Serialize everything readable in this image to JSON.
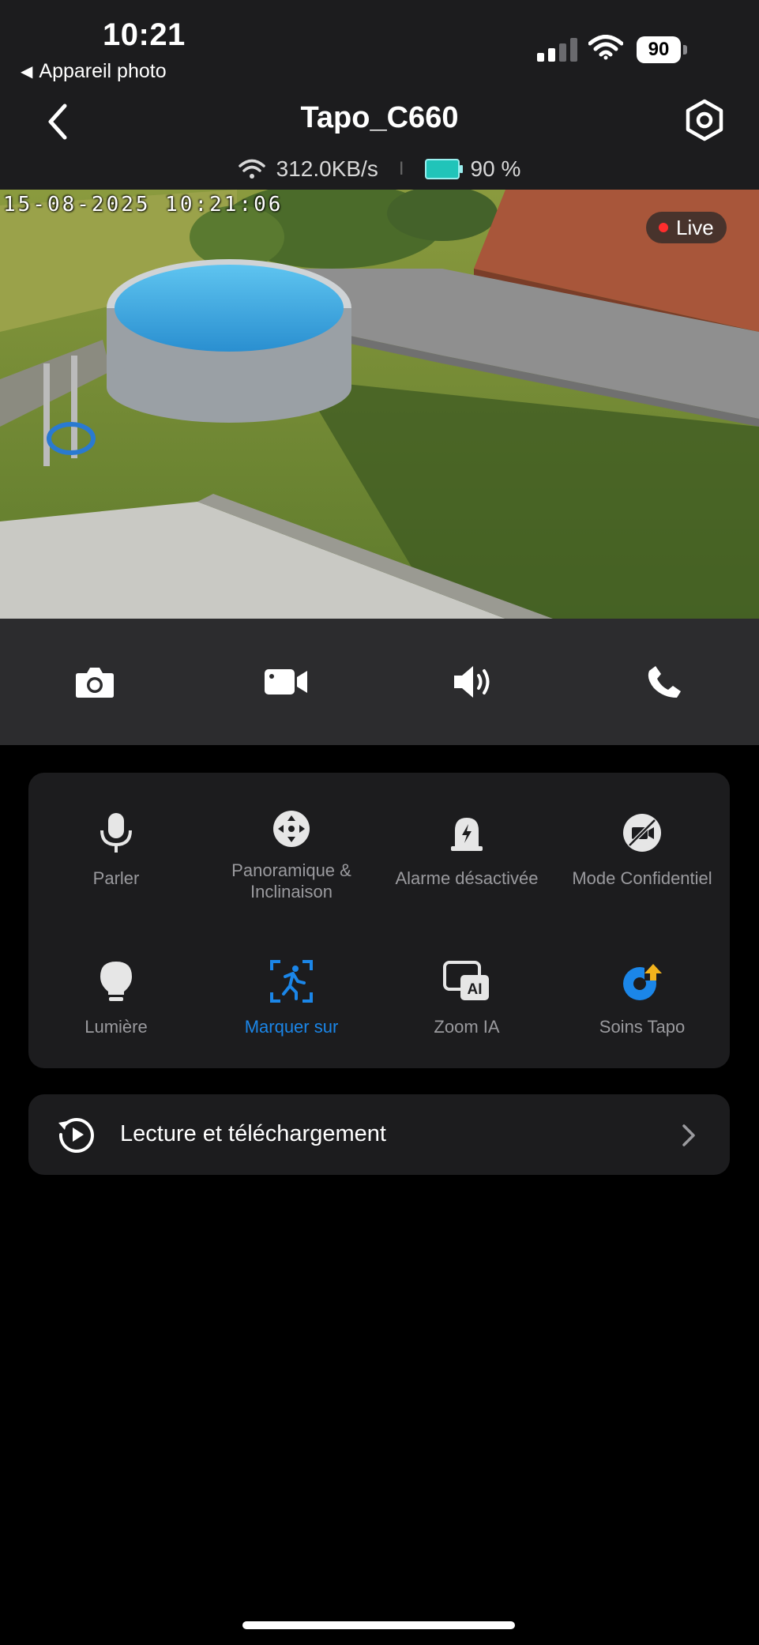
{
  "status_bar": {
    "time": "10:21",
    "back_app": "Appareil photo",
    "battery": "90"
  },
  "header": {
    "title": "Tapo_C660",
    "speed": "312.0KB/s",
    "separator": "I",
    "battery_pct": "90 %"
  },
  "camera": {
    "timestamp": "15-08-2025  10:21:06",
    "live_label": "Live"
  },
  "controls": [
    "camera-icon",
    "video-record-icon",
    "speaker-icon",
    "phone-icon"
  ],
  "features": {
    "items": [
      {
        "label": "Parler",
        "icon": "microphone-icon"
      },
      {
        "label": "Panoramique &\nInclinaison",
        "icon": "pan-tilt-icon"
      },
      {
        "label": "Alarme désactivée",
        "icon": "alarm-icon"
      },
      {
        "label": "Mode Confidentiel",
        "icon": "privacy-icon"
      },
      {
        "label": "Lumière",
        "icon": "light-bulb-icon"
      },
      {
        "label": "Marquer sur",
        "icon": "motion-tracking-icon",
        "active": true
      },
      {
        "label": "Zoom IA",
        "icon": "ai-zoom-icon"
      },
      {
        "label": "Soins Tapo",
        "icon": "tapo-care-icon"
      }
    ],
    "active_color": "#1b86e8"
  },
  "playback": {
    "label": "Lecture et téléchargement"
  },
  "colors": {
    "background": "#000000",
    "panel": "#1c1c1e",
    "control_bar": "#2c2c2e",
    "accent": "#1b86e8",
    "live_dot": "#ff2d2d"
  }
}
